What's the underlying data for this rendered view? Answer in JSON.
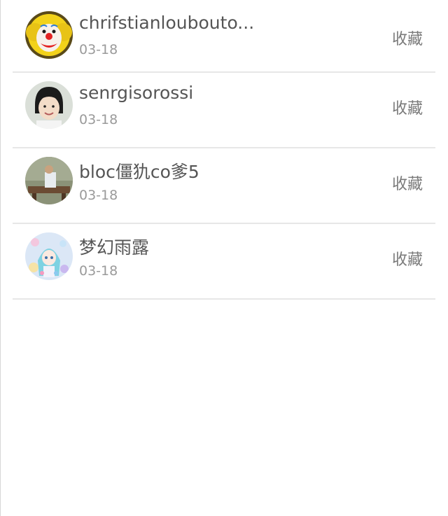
{
  "favorites": [
    {
      "name": "chrifstianloubouto...",
      "date": "03-18",
      "action": "收藏",
      "avatar": "clown-avatar"
    },
    {
      "name": "senrgisorossi",
      "date": "03-18",
      "action": "收藏",
      "avatar": "girl-avatar"
    },
    {
      "name": "bloc僵犰co爹5",
      "date": "03-18",
      "action": "收藏",
      "avatar": "scene-avatar"
    },
    {
      "name": "梦幻雨露",
      "date": "03-18",
      "action": "收藏",
      "avatar": "anime-avatar"
    }
  ]
}
